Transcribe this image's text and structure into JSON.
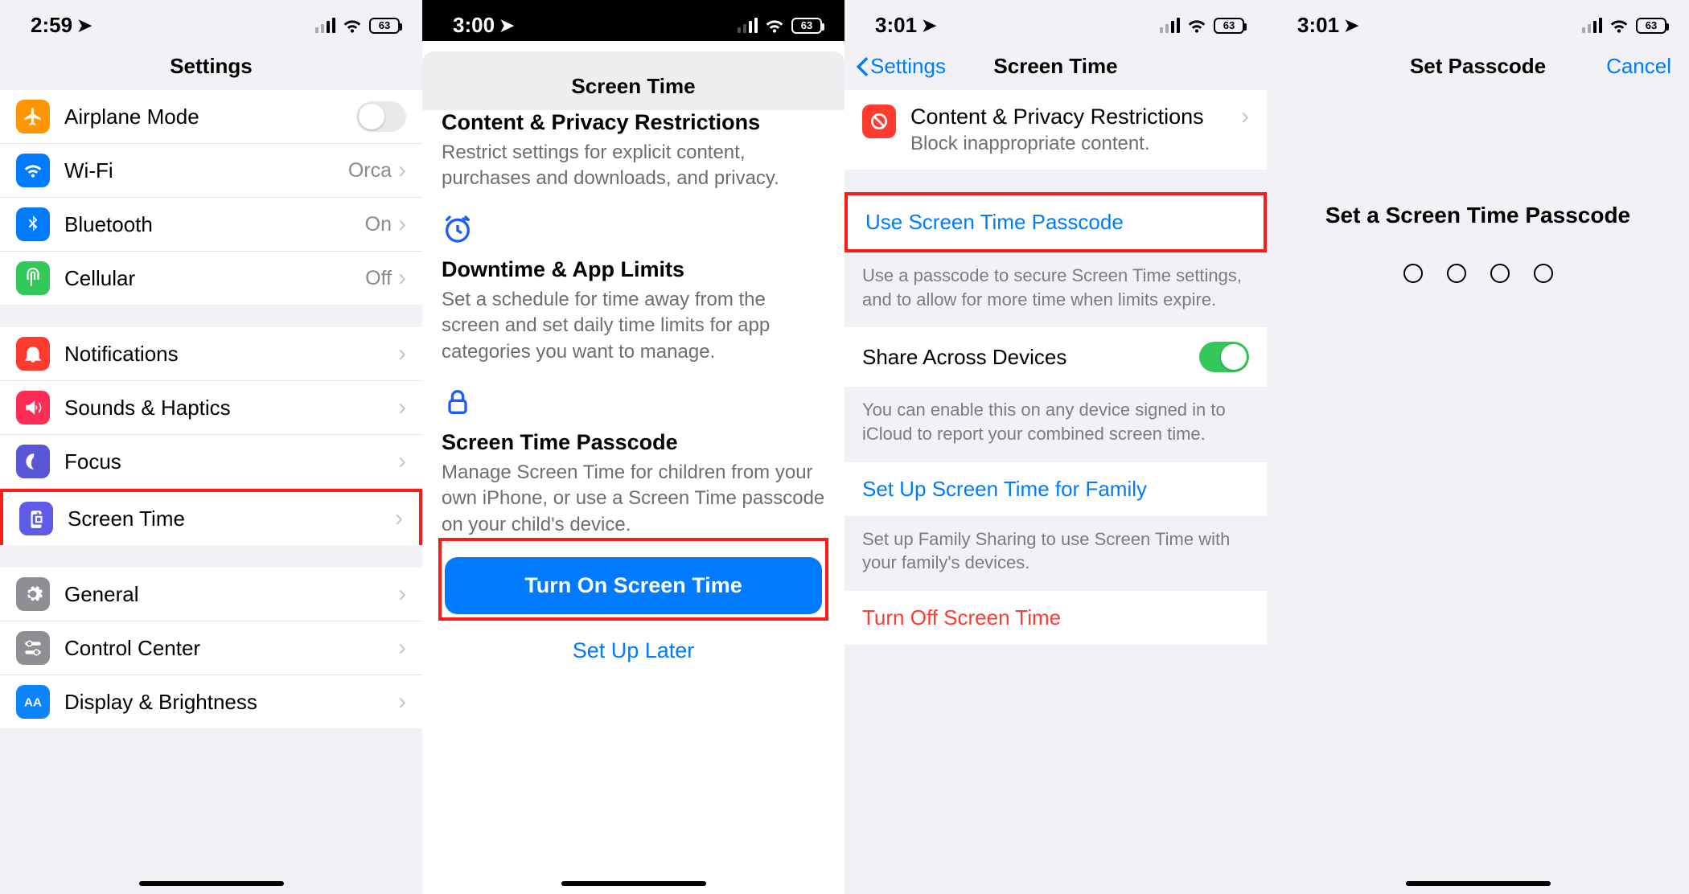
{
  "status": {
    "battery_pct": "63",
    "pane1": {
      "time": "2:59"
    },
    "pane2": {
      "time": "3:00"
    },
    "pane3": {
      "time": "3:01"
    },
    "pane4": {
      "time": "3:01"
    }
  },
  "pane1": {
    "title": "Settings",
    "rows": {
      "airplane": "Airplane Mode",
      "wifi": {
        "label": "Wi-Fi",
        "value": "Orca"
      },
      "bluetooth": {
        "label": "Bluetooth",
        "value": "On"
      },
      "cellular": {
        "label": "Cellular",
        "value": "Off"
      },
      "notifications": "Notifications",
      "sounds": "Sounds & Haptics",
      "focus": "Focus",
      "screentime": "Screen Time",
      "general": "General",
      "controlcenter": "Control Center",
      "display": "Display & Brightness"
    }
  },
  "pane2": {
    "title": "Screen Time",
    "s1": {
      "h": "Content & Privacy Restrictions",
      "p": "Restrict settings for explicit content, purchases and downloads, and privacy."
    },
    "s2": {
      "h": "Downtime & App Limits",
      "p": "Set a schedule for time away from the screen and set daily time limits for app categories you want to manage."
    },
    "s3": {
      "h": "Screen Time Passcode",
      "p": "Manage Screen Time for children from your own iPhone, or use a Screen Time passcode on your child's device."
    },
    "primary_btn": "Turn On Screen Time",
    "secondary": "Set Up Later"
  },
  "pane3": {
    "back": "Settings",
    "title": "Screen Time",
    "cpr": {
      "title": "Content & Privacy Restrictions",
      "sub": "Block inappropriate content."
    },
    "use_passcode": "Use Screen Time Passcode",
    "use_passcode_note": "Use a passcode to secure Screen Time settings, and to allow for more time when limits expire.",
    "share": "Share Across Devices",
    "share_note": "You can enable this on any device signed in to iCloud to report your combined screen time.",
    "family": "Set Up Screen Time for Family",
    "family_note": "Set up Family Sharing to use Screen Time with your family's devices.",
    "turn_off": "Turn Off Screen Time"
  },
  "pane4": {
    "title": "Set Passcode",
    "cancel": "Cancel",
    "prompt": "Set a Screen Time Passcode"
  }
}
